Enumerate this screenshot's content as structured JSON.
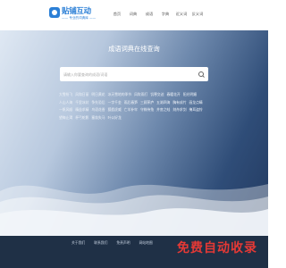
{
  "header": {
    "logo_title": "贴铺互动",
    "logo_subtitle": "—— 专业的词典库 ——",
    "nav": [
      "首页",
      "词典",
      "成语",
      "字典",
      "近义词",
      "反义词"
    ]
  },
  "hero": {
    "title": "成语词典在线查询",
    "search_placeholder": "请输入你要查询的成语/词语"
  },
  "keywords": [
    "大雪纷飞",
    "风和日丽",
    "明日黄花",
    "冰天雪地的季节",
    "风吹雨打",
    "饥寒交迫",
    "春暖花开",
    "阳光明媚",
    "人山人海",
    "千里冰封",
    "争先恐后",
    "一字千金",
    "雨后春笋",
    "三顾茅庐",
    "五湖四海",
    "胸有成竹",
    "画龙点睛",
    "一帆风顺",
    "精益求精",
    "鸟语花香",
    "狐假虎威",
    "亡羊补牢",
    "守株待兔",
    "井底之蛙",
    "刻舟求剑",
    "掩耳盗铃",
    "望梅止渴",
    "杯弓蛇影",
    "塞翁失马",
    "叶公好龙"
  ],
  "footer": {
    "links": [
      "关于我们",
      "联系我们",
      "免责声明",
      "网站地图"
    ]
  },
  "watermark": "免费自动收录"
}
